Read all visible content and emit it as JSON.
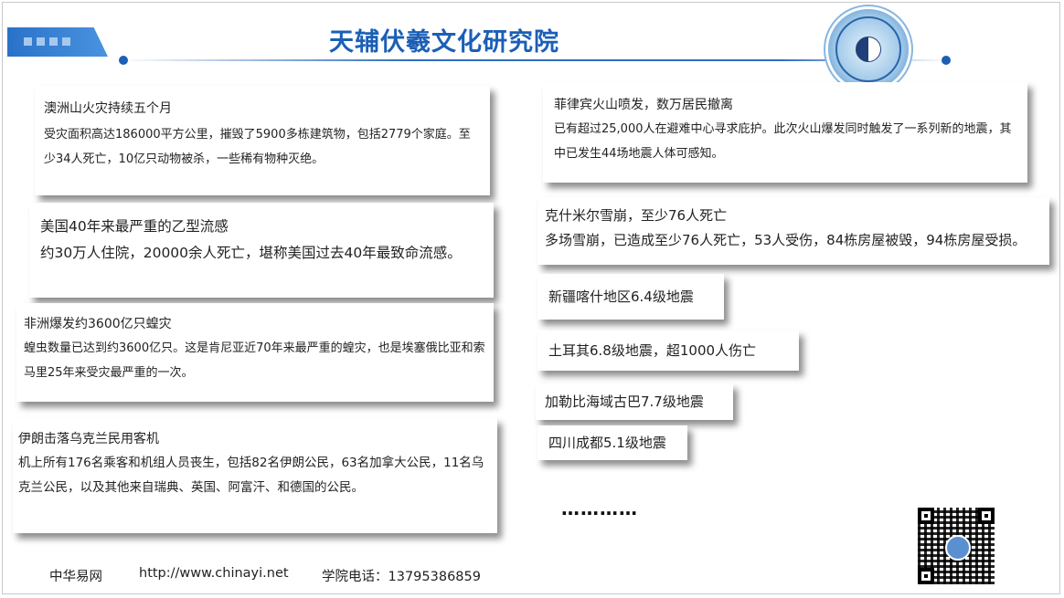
{
  "header": {
    "title": "天辅伏羲文化研究院",
    "logo_text": "天辅伏羲文化研究院"
  },
  "left_cards": [
    {
      "heading": "澳洲山火灾持续五个月",
      "body": "受灾面积高达186000平方公里，摧毁了5900多栋建筑物，包括2779个家庭。至少34人死亡，10亿只动物被杀，一些稀有物种灭绝。"
    },
    {
      "heading": "美国40年来最严重的乙型流感",
      "body": "约30万人住院，20000余人死亡，堪称美国过去40年最致命流感。"
    },
    {
      "heading": "非洲爆发约3600亿只蝗灾",
      "body": "蝗虫数量已达到约3600亿只。这是肯尼亚近70年来最严重的蝗灾，也是埃塞俄比亚和索马里25年来受灾最严重的一次。"
    },
    {
      "heading": "伊朗击落乌克兰民用客机",
      "body": "机上所有176名乘客和机组人员丧生，包括82名伊朗公民，63名加拿大公民，11名乌克兰公民，以及其他来自瑞典、英国、阿富汗、和德国的公民。"
    }
  ],
  "right_cards": [
    {
      "heading": "菲律宾火山喷发，数万居民撤离",
      "body": "已有超过25,000人在避难中心寻求庇护。此次火山爆发同时触发了一系列新的地震，其中已发生44场地震人体可感知。"
    },
    {
      "heading": "克什米尔雪崩，至少76人死亡",
      "body": "多场雪崩，已造成至少76人死亡，53人受伤，84栋房屋被毁，94栋房屋受损。"
    }
  ],
  "right_items": [
    "新疆喀什地区6.4级地震",
    "土耳其6.8级地震，超1000人伤亡",
    "加勒比海域古巴7.7级地震",
    "四川成都5.1级地震"
  ],
  "ellipsis": "…………",
  "footer": {
    "site": "中华易网",
    "url": "http://www.chinayi.net",
    "phone": "学院电话：13795386859"
  },
  "icons": {
    "logo": "institute-logo-icon",
    "qr": "qr-code-icon"
  },
  "colors": {
    "title": "#1b5fb6",
    "accent": "#2a72c8"
  }
}
